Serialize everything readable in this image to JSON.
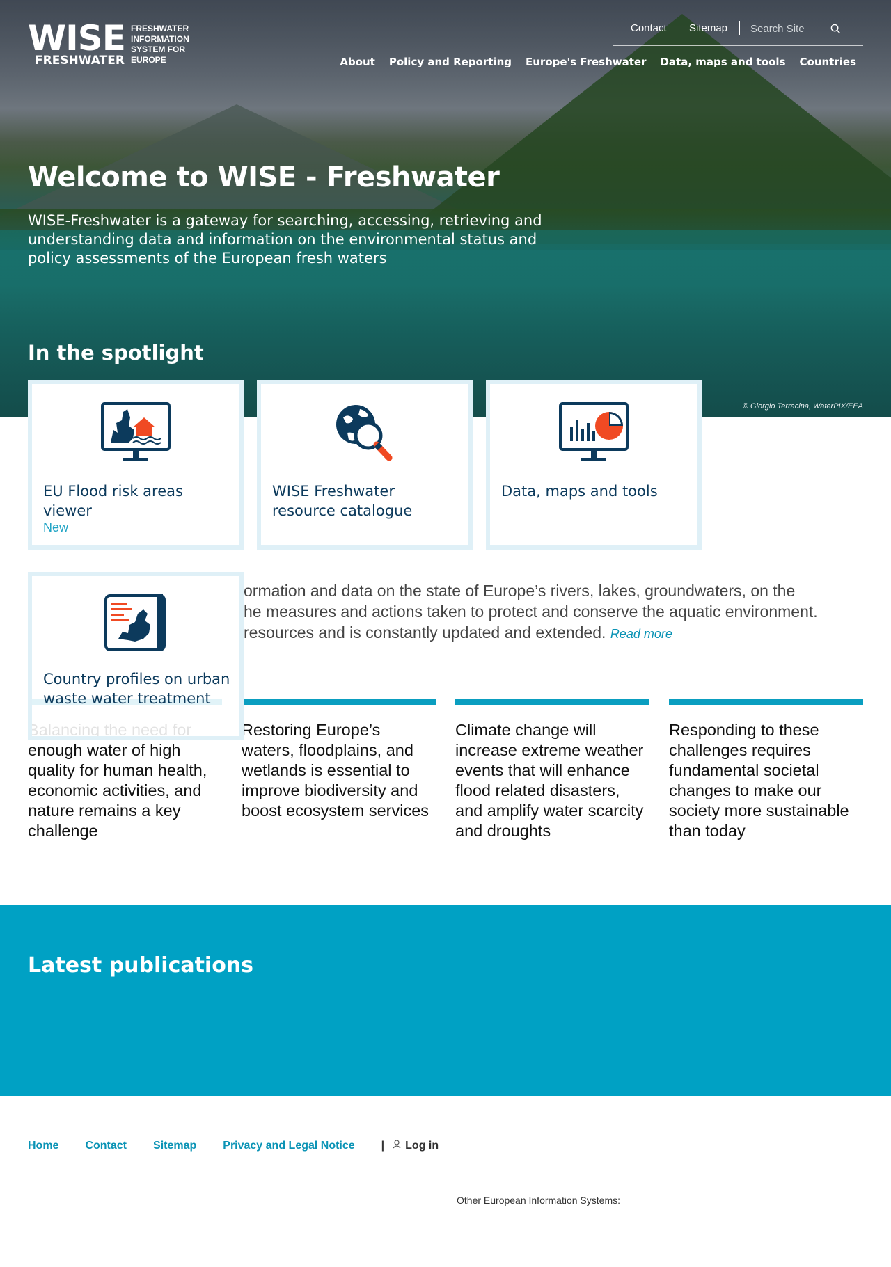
{
  "logo": {
    "big": "WISE",
    "sub": "FRESHWATER",
    "tagline": "FRESHWATER INFORMATION SYSTEM FOR EUROPE"
  },
  "topnav": {
    "contact": "Contact",
    "sitemap": "Sitemap",
    "search_placeholder": "Search Site"
  },
  "mainnav": [
    "About",
    "Policy and Reporting",
    "Europe's Freshwater",
    "Data, maps and tools",
    "Countries"
  ],
  "hero": {
    "title": "Welcome to WISE - Freshwater",
    "description": "WISE-Freshwater is a gateway for searching, accessing, retrieving and understanding data and information on the environmental status and policy assessments of the European fresh waters",
    "credit": "© Giorgio Terracina, WaterPIX/EEA"
  },
  "spotlight": {
    "title": "In the spotlight",
    "cards": [
      {
        "label": "EU Flood risk areas viewer",
        "badge": "New",
        "icon": "flood-map-monitor-icon"
      },
      {
        "label": "WISE Freshwater resource catalogue",
        "icon": "globe-search-icon"
      },
      {
        "label": "Data, maps and tools",
        "icon": "chart-monitor-icon"
      },
      {
        "label": "Country profiles on urban waste water treatment",
        "icon": "europe-map-icon"
      }
    ]
  },
  "intro": {
    "line1": "ormation and data on the state of Europe’s rivers, lakes, groundwaters, on the",
    "line2": "he measures and actions taken to protect and conserve the aquatic environment.",
    "line3": "resources and is constantly updated and extended.",
    "read_more": "Read more"
  },
  "challenges": [
    "Balancing the need for enough water of high quality for human health, economic activities, and nature remains a key challenge",
    "Restoring Europe’s waters, floodplains, and wetlands is essential to improve biodiversity and boost ecosystem services",
    "Climate change will increase extreme weather events that will enhance flood related disasters, and amplify water scarcity and droughts",
    "Responding to these challenges requires fundamental societal changes to make our society more sustainable than today"
  ],
  "publications": {
    "title": "Latest publications"
  },
  "footer": {
    "links": [
      "Home",
      "Contact",
      "Sitemap",
      "Privacy and Legal Notice"
    ],
    "separator": "|",
    "login": "Log in",
    "other": "Other European Information Systems:"
  },
  "colors": {
    "accent": "#0a9ec0",
    "navy": "#0c3a5c",
    "orange": "#f04a23",
    "card_border": "#dff0f7"
  }
}
